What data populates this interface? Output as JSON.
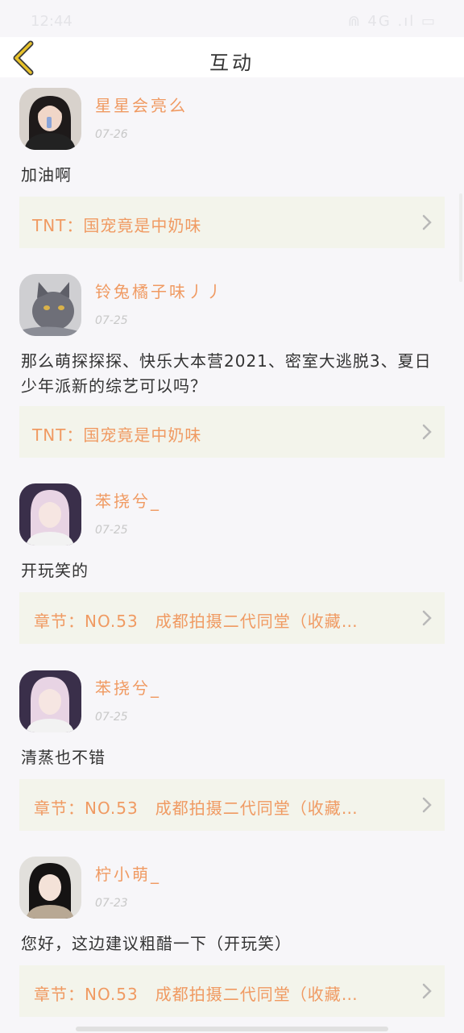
{
  "status_bar": {
    "time": "12:44",
    "icons": "⋒ 4G .ıl ▭"
  },
  "header": {
    "title": "互动"
  },
  "colors": {
    "accent": "#f09a62",
    "card_bg": "#f3f4eb",
    "back_icon": "#e8c22a"
  },
  "comments": [
    {
      "username": "星星会亮么",
      "date": "07-26",
      "text": "加油啊",
      "ref": "TNT：国宠竟是中奶味",
      "avatar": "avatar-girl-dark-hair"
    },
    {
      "username": "铃兔橘子味丿丿",
      "date": "07-25",
      "text": "那么萌探探探、快乐大本营2021、密室大逃脱3、夏日少年派新的综艺可以吗？",
      "ref": "TNT：国宠竟是中奶味",
      "avatar": "avatar-grey-cat"
    },
    {
      "username": "苯挠兮_",
      "date": "07-25",
      "text": "开玩笑的",
      "ref": "章节：NO.53　成都拍摄二代同堂（收藏…",
      "avatar": "avatar-girl-pink-hair"
    },
    {
      "username": "苯挠兮_",
      "date": "07-25",
      "text": "清蒸也不错",
      "ref": "章节：NO.53　成都拍摄二代同堂（收藏…",
      "avatar": "avatar-girl-pink-hair"
    },
    {
      "username": "柠小萌_",
      "date": "07-23",
      "text": "您好，这边建议粗醋一下（开玩笑）",
      "ref": "章节：NO.53　成都拍摄二代同堂（收藏…",
      "avatar": "avatar-girl-black-hair"
    }
  ]
}
